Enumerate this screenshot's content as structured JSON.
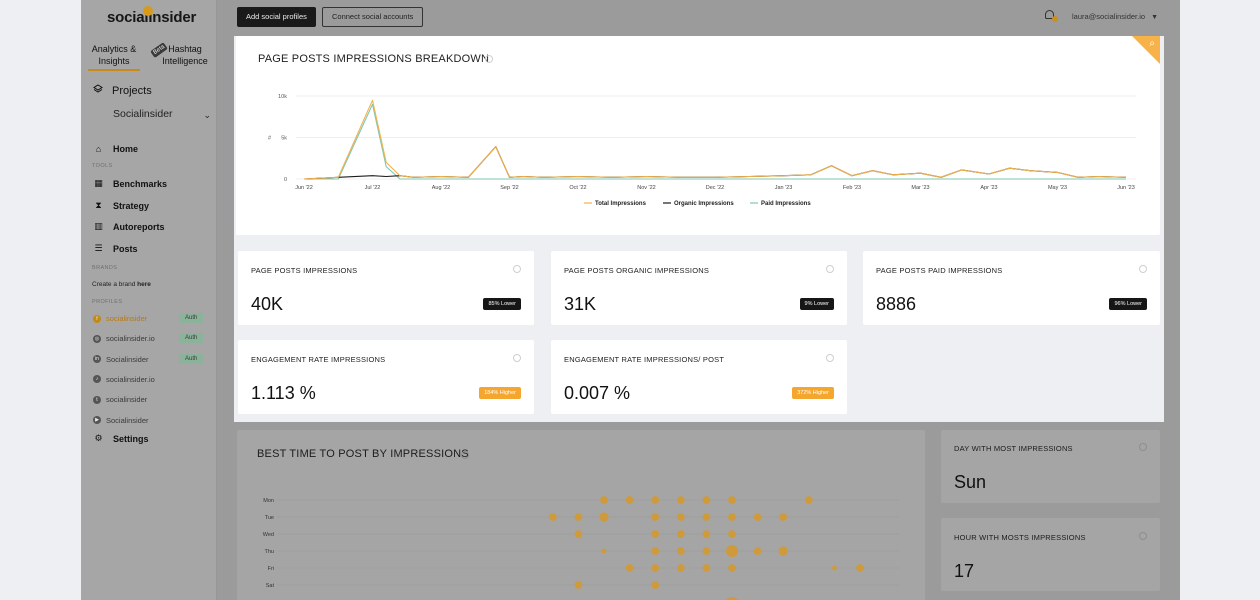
{
  "app": {
    "logo": "socialinsider",
    "nav_tabs": [
      "Analytics &\nInsights",
      "Hashtag\nIntelligence"
    ],
    "beta_label": "Beta",
    "projects_label": "Projects",
    "project_selected": "Socialinsider",
    "menu": {
      "home": "Home",
      "tools_section": "TOOLS",
      "benchmarks": "Benchmarks",
      "strategy": "Strategy",
      "autoreports": "Autoreports",
      "posts": "Posts",
      "brands_section": "BRANDS",
      "create_brand_prefix": "Create a brand ",
      "create_brand_link": "here",
      "profiles_section": "PROFILES",
      "settings": "Settings"
    },
    "profiles": [
      {
        "name": "socialinsider",
        "icon": "facebook-icon",
        "glyph": "f",
        "auth": "Auth"
      },
      {
        "name": "socialinsider.io",
        "icon": "instagram-icon",
        "glyph": "◎",
        "auth": "Auth"
      },
      {
        "name": "Socialinsider",
        "icon": "linkedin-icon",
        "glyph": "in",
        "auth": "Auth"
      },
      {
        "name": "socialinsider.io",
        "icon": "tiktok-icon",
        "glyph": "♪",
        "auth": ""
      },
      {
        "name": "socialinsider",
        "icon": "twitter-icon",
        "glyph": "t",
        "auth": ""
      },
      {
        "name": "Socialinsider",
        "icon": "youtube-icon",
        "glyph": "▶",
        "auth": ""
      }
    ]
  },
  "topbar": {
    "add_profiles": "Add social profiles",
    "connect_accounts": "Connect social accounts",
    "user_email": "laura@socialinsider.io"
  },
  "chart_card": {
    "title": "PAGE POSTS IMPRESSIONS BREAKDOWN"
  },
  "chart_data": {
    "type": "line",
    "title": "PAGE POSTS IMPRESSIONS BREAKDOWN",
    "ylabel": "#",
    "yticks": [
      "10k",
      "5k",
      "0"
    ],
    "ylim": [
      0,
      10000
    ],
    "x_ticks": [
      "Jun '22",
      "Jul '22",
      "Aug '22",
      "Sep '22",
      "Oct '22",
      "Nov '22",
      "Dec '22",
      "Jan '23",
      "Feb '23",
      "Mar '23",
      "Apr '23",
      "May '23",
      "Jun '23"
    ],
    "x": [
      0,
      0.5,
      1,
      1.2,
      1.4,
      1.6,
      2,
      2.4,
      2.8,
      3,
      3.2,
      3.5,
      4,
      4.5,
      5,
      5.5,
      6,
      6.5,
      7,
      7.4,
      7.7,
      8,
      8.3,
      8.6,
      9,
      9.3,
      9.6,
      10,
      10.3,
      10.6,
      11,
      11.3,
      11.6,
      12
    ],
    "series": [
      {
        "name": "Total Impressions",
        "color": "#f3b14c",
        "values": [
          0,
          200,
          9500,
          2000,
          400,
          200,
          300,
          200,
          3900,
          200,
          300,
          200,
          300,
          200,
          300,
          200,
          200,
          300,
          400,
          500,
          1600,
          400,
          1000,
          500,
          700,
          200,
          1100,
          600,
          1300,
          1000,
          800,
          200,
          300,
          200
        ]
      },
      {
        "name": "Organic Impressions",
        "color": "#1c1c1c",
        "values": [
          0,
          200,
          400,
          300,
          400,
          200,
          300,
          200,
          3900,
          200,
          300,
          200,
          300,
          200,
          300,
          200,
          200,
          300,
          400,
          500,
          1600,
          400,
          1000,
          500,
          700,
          200,
          1100,
          600,
          1300,
          1000,
          800,
          200,
          300,
          200
        ]
      },
      {
        "name": "Paid Impressions",
        "color": "#7fc7b1",
        "values": [
          0,
          0,
          9000,
          1500,
          0,
          0,
          0,
          0,
          0,
          0,
          0,
          0,
          0,
          0,
          0,
          0,
          0,
          0,
          0,
          0,
          0,
          0,
          0,
          0,
          0,
          0,
          0,
          0,
          0,
          0,
          0,
          0,
          0,
          0
        ]
      }
    ],
    "legend_position": "bottom"
  },
  "stats": [
    {
      "title": "PAGE POSTS IMPRESSIONS",
      "value": "40K",
      "badge": "85% Lower",
      "badge_type": "dark"
    },
    {
      "title": "PAGE POSTS ORGANIC IMPRESSIONS",
      "value": "31K",
      "badge": "9% Lower",
      "badge_type": "dark"
    },
    {
      "title": "PAGE POSTS PAID IMPRESSIONS",
      "value": "8886",
      "badge": "96% Lower",
      "badge_type": "dark"
    },
    {
      "title": "ENGAGEMENT RATE IMPRESSIONS",
      "value": "1.113 %",
      "badge": "184% Higher",
      "badge_type": "orange"
    },
    {
      "title": "ENGAGEMENT RATE IMPRESSIONS/ POST",
      "value": "0.007 %",
      "badge": "372% Higher",
      "badge_type": "orange"
    }
  ],
  "best_time": {
    "title": "BEST TIME TO POST BY IMPRESSIONS",
    "days": [
      "Mon",
      "Tue",
      "Wed",
      "Thu",
      "Fri",
      "Sat"
    ],
    "bubbles": [
      [
        0,
        14,
        2
      ],
      [
        0,
        15,
        2
      ],
      [
        0,
        16,
        2
      ],
      [
        0,
        17,
        2
      ],
      [
        0,
        18,
        2
      ],
      [
        0,
        19,
        2
      ],
      [
        0,
        22,
        2
      ],
      [
        1,
        12,
        2
      ],
      [
        1,
        13,
        2
      ],
      [
        1,
        14,
        3
      ],
      [
        1,
        16,
        2
      ],
      [
        1,
        17,
        2
      ],
      [
        1,
        18,
        2
      ],
      [
        1,
        19,
        2
      ],
      [
        1,
        20,
        2
      ],
      [
        1,
        21,
        2
      ],
      [
        2,
        13,
        2
      ],
      [
        2,
        16,
        2
      ],
      [
        2,
        17,
        2
      ],
      [
        2,
        18,
        2
      ],
      [
        2,
        19,
        2
      ],
      [
        3,
        14,
        1
      ],
      [
        3,
        16,
        2
      ],
      [
        3,
        17,
        2
      ],
      [
        3,
        18,
        2
      ],
      [
        3,
        19,
        4
      ],
      [
        3,
        20,
        2
      ],
      [
        3,
        21,
        3
      ],
      [
        4,
        15,
        2
      ],
      [
        4,
        16,
        2
      ],
      [
        4,
        17,
        2
      ],
      [
        4,
        18,
        2
      ],
      [
        4,
        19,
        2
      ],
      [
        4,
        23,
        1
      ],
      [
        4,
        24,
        2
      ],
      [
        5,
        13,
        2
      ],
      [
        5,
        16,
        2
      ]
    ],
    "bubble_color": "#cf9a3c"
  },
  "day_most": {
    "title": "DAY WITH MOST IMPRESSIONS",
    "value": "Sun"
  },
  "hour_most": {
    "title": "HOUR WITH MOSTS IMPRESSIONS",
    "value": "17"
  }
}
